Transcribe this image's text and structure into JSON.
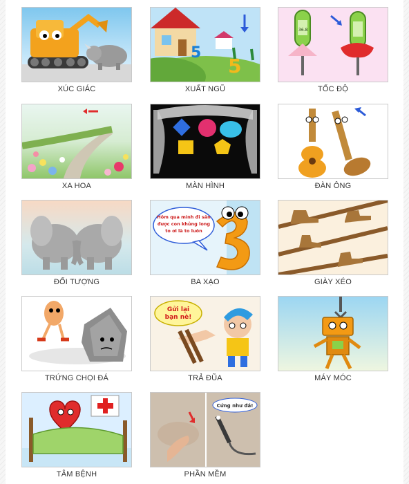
{
  "items": [
    {
      "label": "XÚC GIÁC",
      "icon": "excavator-rhino-image"
    },
    {
      "label": "XUẤT NGŨ",
      "icon": "house-numbers-image"
    },
    {
      "label": "TỐC ĐỘ",
      "icon": "thermometers-image"
    },
    {
      "label": "XA HOA",
      "icon": "flower-road-image"
    },
    {
      "label": "MÀN HÌNH",
      "icon": "curtain-shapes-image"
    },
    {
      "label": "ĐÀN ÔNG",
      "icon": "guitars-image"
    },
    {
      "label": "ĐỐI TƯỢNG",
      "icon": "elephants-image"
    },
    {
      "label": "BA XẠO",
      "icon": "number-three-image"
    },
    {
      "label": "GIÀY XÉO",
      "icon": "shoes-shelves-image"
    },
    {
      "label": "TRỨNG CHỌI ĐÁ",
      "icon": "egg-rock-image"
    },
    {
      "label": "TRẢ ĐŨA",
      "icon": "boy-chopsticks-image"
    },
    {
      "label": "MÁY MÓC",
      "icon": "robot-crane-image"
    },
    {
      "label": "TÂM BỆNH",
      "icon": "sick-heart-image"
    },
    {
      "label": "PHẦN MỀM",
      "icon": "soft-pen-image"
    }
  ],
  "speech": {
    "ba_xao": [
      "Hôm qua mình đi săn",
      "được con khủng long",
      "to ơi là to luôn"
    ],
    "tra_dua": [
      "Gửi lại",
      "bạn nè!"
    ],
    "phan_mem": "Cứng như đá!",
    "therm_value": "36.8"
  }
}
